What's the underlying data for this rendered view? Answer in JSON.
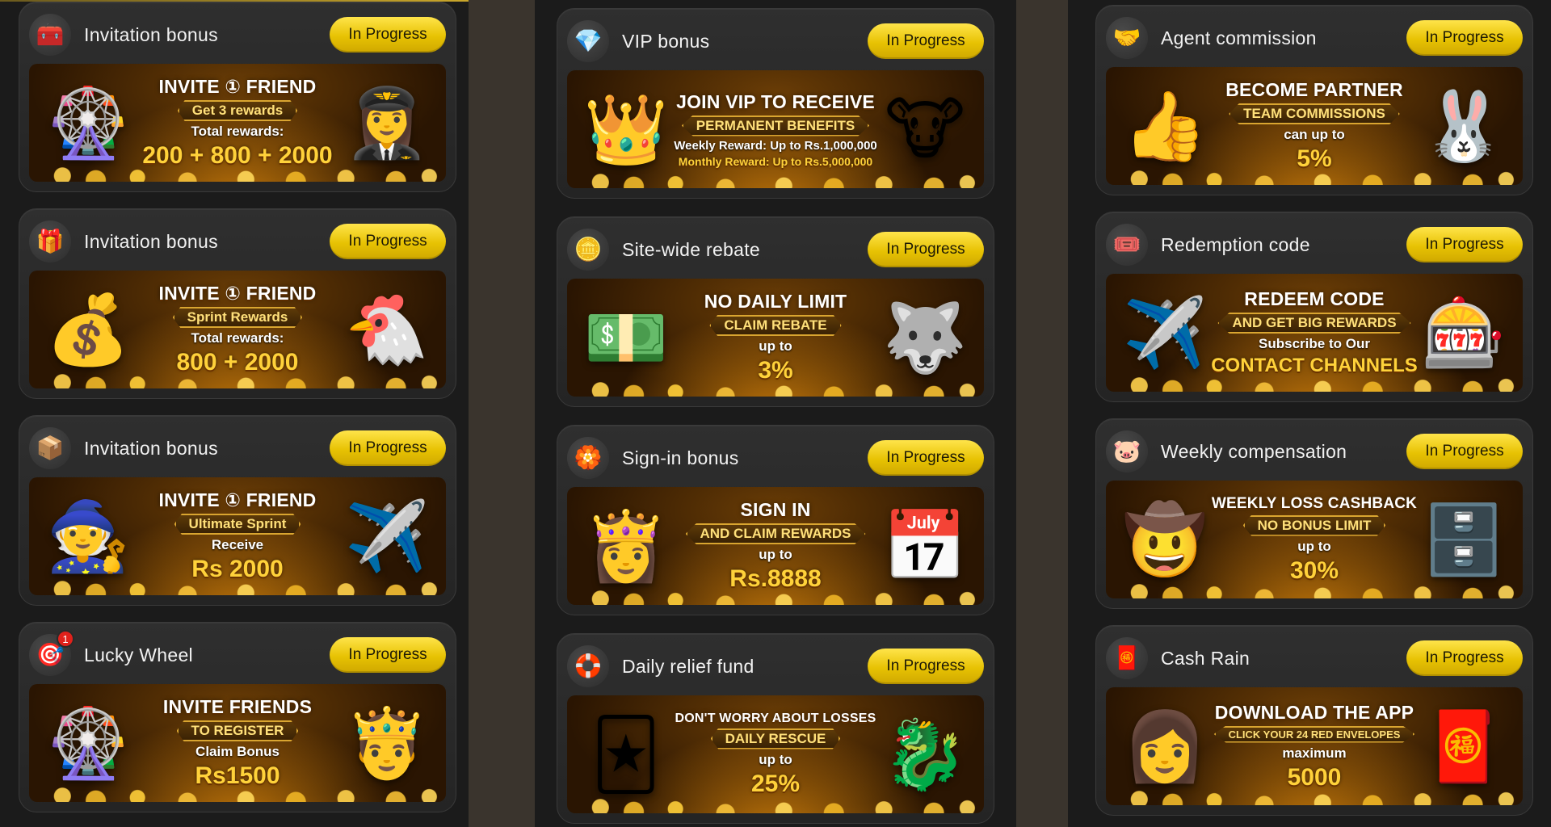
{
  "status_label": "In Progress",
  "columns": [
    {
      "cards": [
        {
          "title": "Invitation bonus",
          "icon": "treasure-chest-icon",
          "glyph": "🧰",
          "badge": "",
          "banner": {
            "l1": "INVITE ① FRIEND",
            "l2": "Get 3 rewards",
            "l3": "Total rewards:",
            "l4": "200 + 800 + 2000",
            "art_left": "🎡",
            "art_right": "👩‍✈️"
          }
        },
        {
          "title": "Invitation bonus",
          "icon": "gift-star-icon",
          "glyph": "🎁",
          "badge": "",
          "banner": {
            "l1": "INVITE ① FRIEND",
            "l2": "Sprint Rewards",
            "l3": "Total rewards:",
            "l4": "800 + 2000",
            "art_left": "💰",
            "art_right": "🐔"
          }
        },
        {
          "title": "Invitation bonus",
          "icon": "treasure-chest-icon",
          "glyph": "📦",
          "badge": "",
          "banner": {
            "l1": "INVITE ① FRIEND",
            "l2": "Ultimate Sprint",
            "l3": "Receive",
            "l4": "Rs 2000",
            "art_left": "🧙",
            "art_right": "✈️"
          }
        },
        {
          "title": "Lucky Wheel",
          "icon": "lucky-wheel-icon",
          "glyph": "🎯",
          "badge": "1",
          "banner": {
            "l1": "INVITE FRIENDS",
            "l2": "TO REGISTER",
            "l3": "Claim Bonus",
            "l4": "Rs1500",
            "art_left": "🎡",
            "art_right": "🤴"
          }
        }
      ]
    },
    {
      "cards": [
        {
          "title": "VIP bonus",
          "icon": "diamond-icon",
          "glyph": "💎",
          "badge": "",
          "banner": {
            "l1": "JOIN VIP TO RECEIVE",
            "l2": "PERMANENT BENEFITS",
            "l3": "Weekly Reward: Up to Rs.1,000,000",
            "l4": "Monthly Reward: Up to Rs.5,000,000",
            "art_left": "👑",
            "art_right": "🐮"
          }
        },
        {
          "title": "Site-wide rebate",
          "icon": "rebate-coin-icon",
          "glyph": "🪙",
          "badge": "",
          "banner": {
            "l1": "NO DAILY LIMIT",
            "l2": "CLAIM REBATE",
            "l3": "up to",
            "l4": "3%",
            "art_left": "💵",
            "art_right": "🐺"
          }
        },
        {
          "title": "Sign-in bonus",
          "icon": "sign-in-badge-icon",
          "glyph": "🏵️",
          "badge": "",
          "banner": {
            "l1": "SIGN IN",
            "l2": "AND CLAIM REWARDS",
            "l3": "up to",
            "l4": "Rs.8888",
            "art_left": "👸",
            "art_right": "📅"
          }
        },
        {
          "title": "Daily relief fund",
          "icon": "life-ring-icon",
          "glyph": "🛟",
          "badge": "",
          "banner": {
            "l1": "DON'T WORRY ABOUT LOSSES",
            "l2": "DAILY RESCUE",
            "l3": "up to",
            "l4": "25%",
            "art_left": "🃏",
            "art_right": "🐉"
          }
        }
      ]
    },
    {
      "cards": [
        {
          "title": "Agent commission",
          "icon": "agent-hand-icon",
          "glyph": "🤝",
          "badge": "",
          "banner": {
            "l1": "BECOME PARTNER",
            "l2": "TEAM COMMISSIONS",
            "l3": "can up to",
            "l4": "5%",
            "art_left": "👍",
            "art_right": "🐰"
          }
        },
        {
          "title": "Redemption code",
          "icon": "ticket-icon",
          "glyph": "🎟️",
          "badge": "",
          "banner": {
            "l1": "REDEEM CODE",
            "l2": "AND GET BIG REWARDS",
            "l3": "Subscribe to Our",
            "l4": "CONTACT CHANNELS",
            "art_left": "✈️",
            "art_right": "🎰"
          }
        },
        {
          "title": "Weekly compensation",
          "icon": "piggy-bank-icon",
          "glyph": "🐷",
          "badge": "",
          "banner": {
            "l1": "WEEKLY LOSS CASHBACK",
            "l2": "NO BONUS LIMIT",
            "l3": "up to",
            "l4": "30%",
            "art_left": "🤠",
            "art_right": "🗄️"
          }
        },
        {
          "title": "Cash Rain",
          "icon": "red-envelope-icon",
          "glyph": "🧧",
          "badge": "",
          "banner": {
            "l1": "DOWNLOAD THE APP",
            "l2": "CLICK YOUR 24 RED ENVELOPES",
            "l3": "maximum",
            "l4": "5000",
            "art_left": "👩",
            "art_right": "🧧"
          }
        }
      ]
    }
  ]
}
